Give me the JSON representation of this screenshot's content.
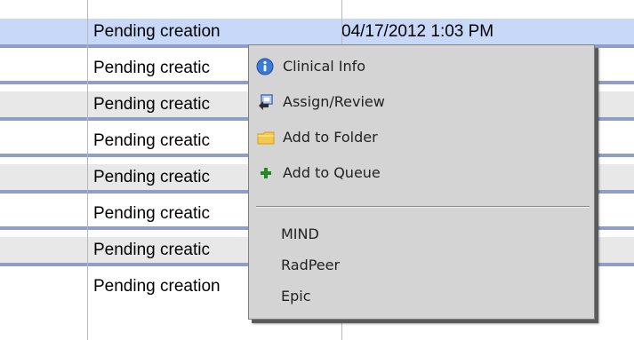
{
  "table": {
    "top_partial_row": {
      "status": "",
      "date": ""
    },
    "rows": [
      {
        "status": "Pending creation",
        "date": "04/17/2012 1:03 PM"
      },
      {
        "status": "Pending creatic",
        "date": ""
      },
      {
        "status": "Pending creatic",
        "date": ""
      },
      {
        "status": "Pending creatic",
        "date": ""
      },
      {
        "status": "Pending creatic",
        "date": ""
      },
      {
        "status": "Pending creatic",
        "date": ""
      },
      {
        "status": "Pending creatic",
        "date": ""
      },
      {
        "status": "Pending creation",
        "date": ""
      }
    ]
  },
  "context_menu": {
    "items": [
      {
        "label": "Clinical Info",
        "icon": "info-icon",
        "icon_color": "#3a7bd5"
      },
      {
        "label": "Assign/Review",
        "icon": "assign-review-icon",
        "icon_color": "#2a5db0"
      },
      {
        "label": "Add to Folder",
        "icon": "folder-icon",
        "icon_color": "#f2c94c"
      },
      {
        "label": "Add to Queue",
        "icon": "plus-icon",
        "icon_color": "#1f8b24"
      }
    ],
    "links": [
      {
        "label": "MIND"
      },
      {
        "label": "RadPeer"
      },
      {
        "label": "Epic"
      }
    ]
  },
  "colors": {
    "row_separator": "#8f9ec9",
    "selected_row": "#c8d8f8",
    "alt_row": "#e8e8e8",
    "menu_background": "#d4d4d4"
  }
}
